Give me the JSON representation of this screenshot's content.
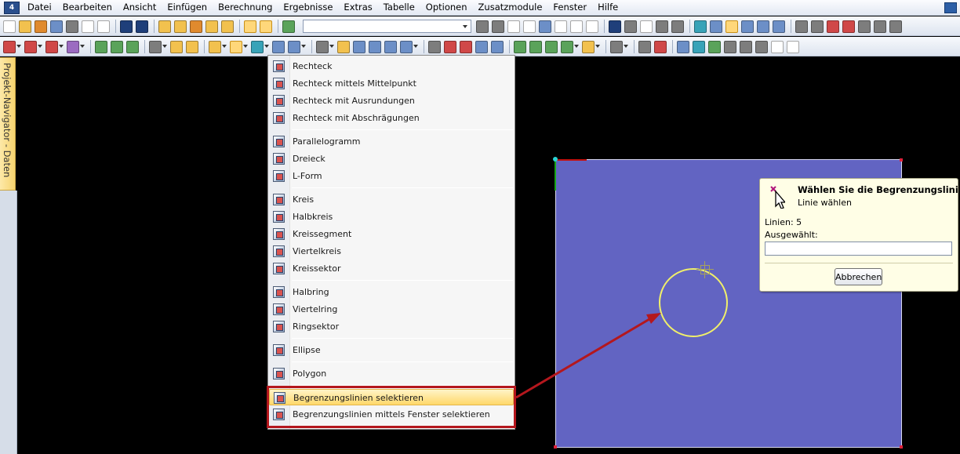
{
  "menubar": {
    "items": [
      "Datei",
      "Bearbeiten",
      "Ansicht",
      "Einfügen",
      "Berechnung",
      "Ergebnisse",
      "Extras",
      "Tabelle",
      "Optionen",
      "Zusatzmodule",
      "Fenster",
      "Hilfe"
    ]
  },
  "navigator": {
    "tab_label": "Projekt-Navigator - Daten"
  },
  "toolbar1": {
    "combo_value": ""
  },
  "dropdown": {
    "items": [
      "Rechteck",
      "Rechteck mittels Mittelpunkt",
      "Rechteck mit Ausrundungen",
      "Rechteck mit Abschrägungen",
      "Parallelogramm",
      "Dreieck",
      "L-Form",
      "Kreis",
      "Halbkreis",
      "Kreissegment",
      "Viertelkreis",
      "Kreissektor",
      "Halbring",
      "Viertelring",
      "Ringsektor",
      "Ellipse",
      "Polygon",
      "Begrenzungslinien selektieren",
      "Begrenzungslinien mittels Fenster selektieren"
    ],
    "highlighted_item": "Begrenzungslinien selektieren"
  },
  "dialog": {
    "title": "Wählen Sie die Begrenzungslinien!",
    "subtitle": "Linie wählen",
    "count_text": "Linien: 5",
    "selected_label": "Ausgewählt:",
    "selected_value": "",
    "cancel_label": "Abbrechen"
  },
  "colors": {
    "surface": "#6264c2",
    "highlight_box": "#b4171d",
    "circle": "#f0ef6a",
    "dialog_bg": "#fffee6"
  }
}
